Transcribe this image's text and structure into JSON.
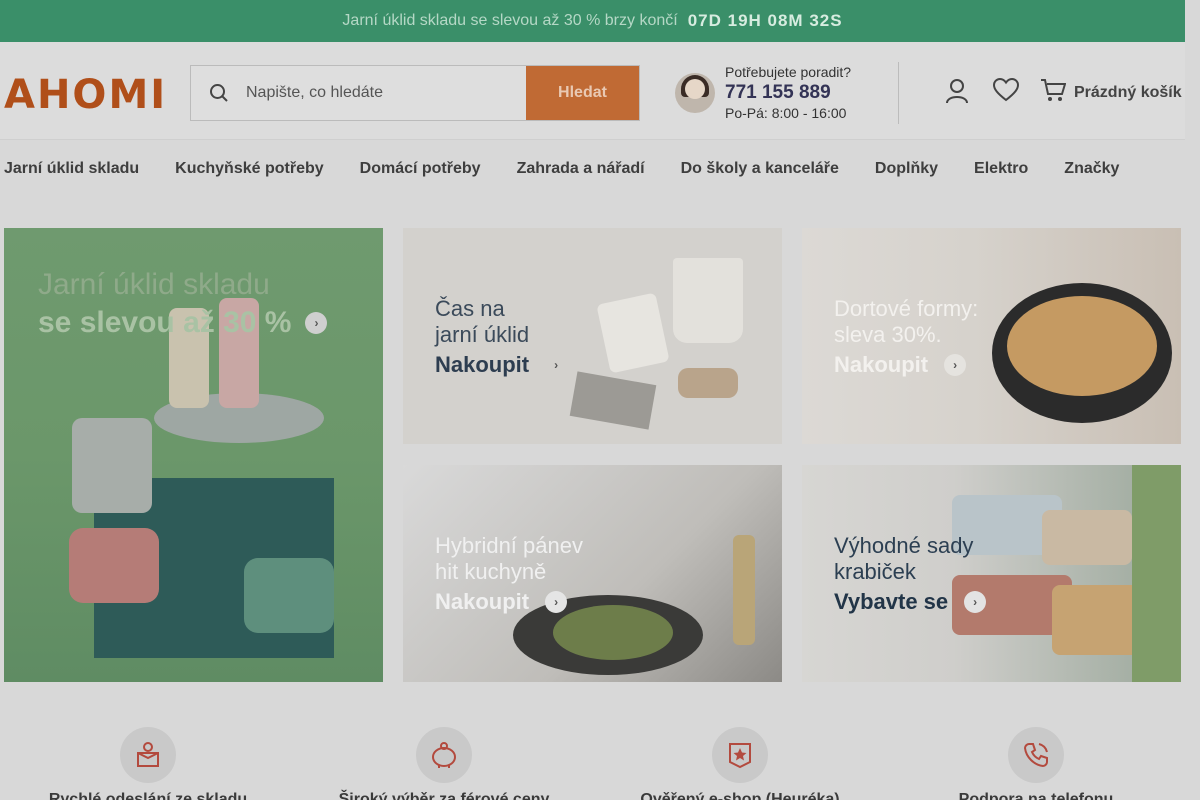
{
  "banner": {
    "text": "Jarní úklid skladu se slevou až 30 % brzy končí ",
    "countdown": "07D 19H 08M 32S"
  },
  "header": {
    "logo": "AHOMI",
    "search_placeholder": "Napište, co hledáte",
    "search_button": "Hledat",
    "help_question": "Potřebujete poradit?",
    "help_phone": "771 155 889",
    "help_hours": "Po-Pá: 8:00 - 16:00",
    "cart_label": "Prázdný košík"
  },
  "nav": {
    "items": [
      "Jarní úklid skladu ",
      "Kuchyňské potřeby",
      "Domácí potřeby",
      "Zahrada a nářadí",
      "Do školy a kanceláře",
      "Doplňky",
      "Elektro",
      "Značky"
    ]
  },
  "tiles": {
    "main": {
      "line1": "Jarní úklid skladu",
      "line2": "se slevou až 30 %"
    },
    "cleaning": {
      "line1": "Čas na",
      "line2": "jarní úklid",
      "cta": "Nakoupit"
    },
    "cake": {
      "line1": "Dortové formy:",
      "line2": "sleva 30%.",
      "cta": "Nakoupit"
    },
    "pan": {
      "line1": "Hybridní pánev",
      "line2": "hit kuchyně",
      "cta": "Nakoupit"
    },
    "boxes": {
      "line1": "Výhodné sady",
      "line2": "krabiček",
      "cta": "Vybavte se"
    }
  },
  "features": [
    {
      "label": "Rychlé odeslání ze skladu",
      "icon": "package-icon"
    },
    {
      "label": "Široký výběr za férové ceny",
      "icon": "piggy-bank-icon"
    },
    {
      "label": "Ověřený e-shop (Heuréka)",
      "icon": "verified-star-icon"
    },
    {
      "label": "Podpora na telefonu",
      "icon": "phone-icon"
    }
  ]
}
